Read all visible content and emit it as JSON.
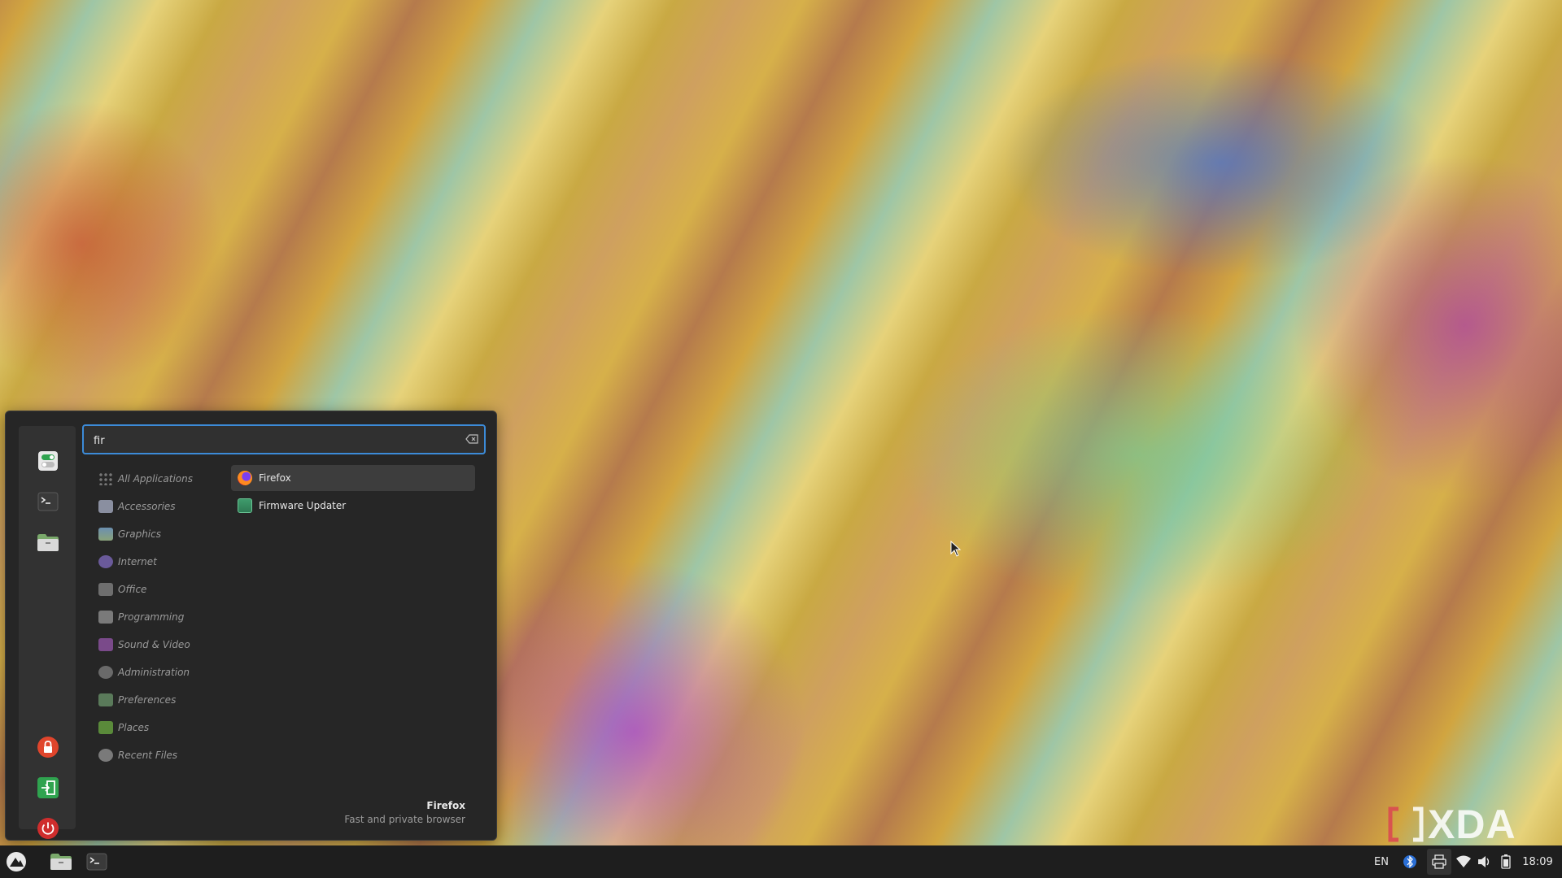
{
  "colors": {
    "accent": "#3c8bd8",
    "lock": "#e0452c",
    "logout": "#2fa34f",
    "power": "#cf2d2d"
  },
  "menu": {
    "favorites": [
      {
        "icon": "settings-toggle-icon"
      },
      {
        "icon": "terminal-icon"
      },
      {
        "icon": "folder-icon"
      }
    ],
    "session_buttons": [
      {
        "icon": "lock-icon"
      },
      {
        "icon": "logout-icon"
      },
      {
        "icon": "power-icon"
      }
    ],
    "search": {
      "value": "fir",
      "placeholder": ""
    },
    "categories": [
      {
        "label": "All Applications",
        "icon": "grid-icon"
      },
      {
        "label": "Accessories",
        "icon": "accessories-icon"
      },
      {
        "label": "Graphics",
        "icon": "graphics-icon"
      },
      {
        "label": "Internet",
        "icon": "internet-icon"
      },
      {
        "label": "Office",
        "icon": "office-icon"
      },
      {
        "label": "Programming",
        "icon": "programming-icon"
      },
      {
        "label": "Sound & Video",
        "icon": "sound-video-icon"
      },
      {
        "label": "Administration",
        "icon": "administration-icon"
      },
      {
        "label": "Preferences",
        "icon": "preferences-icon"
      },
      {
        "label": "Places",
        "icon": "places-icon"
      },
      {
        "label": "Recent Files",
        "icon": "recent-files-icon"
      }
    ],
    "results": [
      {
        "label": "Firefox",
        "icon": "firefox-icon",
        "selected": true
      },
      {
        "label": "Firmware Updater",
        "icon": "firmware-updater-icon",
        "selected": false
      }
    ],
    "description": {
      "title": "Firefox",
      "subtitle": "Fast and private browser"
    }
  },
  "taskbar": {
    "keyboard_layout": "EN",
    "clock": "18:09"
  },
  "watermark": "XDA"
}
